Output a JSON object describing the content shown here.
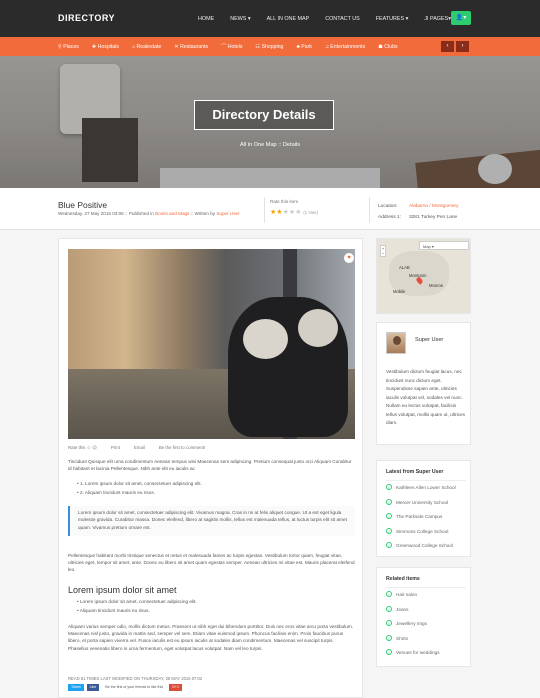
{
  "topbar": {
    "logo": "DIRECTORY",
    "nav": [
      "HOME",
      "NEWS ▾",
      "ALL IN ONE MAP",
      "CONTACT US",
      "FEATURES ▾",
      "JI PAGES▾"
    ],
    "user_icon": "user-icon"
  },
  "categories": [
    "⚲ Places",
    "✚ Hospitals",
    "⌂ Realestate",
    "✕ Restaurants",
    "⌒ Hotels",
    "☷ Shopping",
    "♣ Park",
    "♫ Entertainments",
    "☗ Clubs"
  ],
  "hero": {
    "title": "Directory Details",
    "breadcrumb": "All in One Map :: Details"
  },
  "post": {
    "title": "Blue Positive",
    "date": "Wednesday, 27 May 2015 03:06",
    "published_in_label": ":: Published in",
    "category": "Books and Mags",
    "written_by_label": ":: Written by",
    "author": "Super User",
    "rate_label": "Rate this item",
    "votes": "(1 Vote)",
    "location_label": "Location:",
    "location_value": "Alabama / Montgomery",
    "address_label": "Address 1:",
    "address_value": "3281 Turkey Pen Lane"
  },
  "actions": [
    "Rate this ☺ ☹",
    "Print",
    "Email",
    "Be the first to comment!"
  ],
  "body": {
    "p1": "Tincidunt Quisque elit urna condimentum Aenean tempus wisi Maecenas sem adipiscing. Pretium consequat justo orci Aliquam Curabitur id habitant et lacinia Pellentesque. Nibh ante elit eu iaculis ac",
    "ol": [
      "1. Lorem ipsum dolor sit amet, consectetuer adipiscing elit.",
      "2. Aliquam tincidunt mauris eu risus."
    ],
    "quote": "Lorem ipsum dolor sit amet, consectetuer adipiscing elit. Vivamus magna. Cras in mi at felis aliquet congue. Ut a est eget ligula molestie gravida. Curabitur massa. Donec eleifend, libero at sagittis mollis, tellus est malesuada tellus, at luctus turpis elit sit amet quam. Vivamus pretium ornare est.",
    "p2": "Pellentesque habitant morbi tristique senectus et netus et malesuada fames ac turpis egestas. Vestibulum tortor quam, feugiat vitae, ultricies eget, tempor sit amet, ante. Donec eu libero sit amet quam egestas semper. Aenean ultricies mi vitae est. Mauris placerat eleifend leo.",
    "h2": "Lorem ipsum dolor sit amet",
    "ul": [
      "Lorem ipsum dolor sit amet, consectetuer adipiscing elit.",
      "Aliquam tincidunt mauris eu risus."
    ],
    "p3": "Aliquam varius semper odio, mollis dictum metus. Praesent ut nibh eget dui bibendum porttitor. Duis nec eros vitae arcu porta vestibulum. Maecenas nisl justo, gravida in mattis sed, semper vel sem. Etiam vitae euismod ipsum. Phoncus facilisis enim. Proin faucibus purus libero, et porta sapien viverra vel. Fusce iaculis est eu ipsum iaculis at sodales diam condimentum. Maecenas vel suscipit turpis. Phasellus venenatis libero in urna fermentum, eget volutpat lacus volutpat. Nam vel leo turpis.",
    "footer": "READ 51 TIMES      LAST MODIFIED ON THURSDAY, 28 MAY 2015 07:02",
    "social": [
      "Tweet",
      "Like",
      "Be the first of your friends to like this",
      "G+1"
    ]
  },
  "map": {
    "button": "Map ▾",
    "cities": [
      "ALAB",
      "Montgom",
      "Mobile",
      "Monroe"
    ]
  },
  "author_box": {
    "name": "Super User",
    "bio": "Vestibulum dictum feugiat lacus, nec tincidunt nunc dictum eget. Suspendisse sapien ante, ultricies iaculis volutpat vel, sodales vel nunc. Nullam eu lectus volutpat, facilisis tellus volutpat, mollis quam ut, ultrices diam."
  },
  "latest": {
    "title": "Latest from Super User",
    "items": [
      "Kathleen Allen Lower School",
      "Mercer University School",
      "The Parkside Campus",
      "Simmons College School",
      "Greenwood College School"
    ]
  },
  "related": {
    "title": "Related items",
    "items": [
      "Hair salon",
      "Jeans",
      "Jewellery rings",
      "Shirts",
      "Venues for weddings"
    ]
  },
  "colors": {
    "accent": "#f26b3a",
    "dark": "#2b2b2b",
    "green": "#2ecc71",
    "quote": "#3b8fd9"
  }
}
